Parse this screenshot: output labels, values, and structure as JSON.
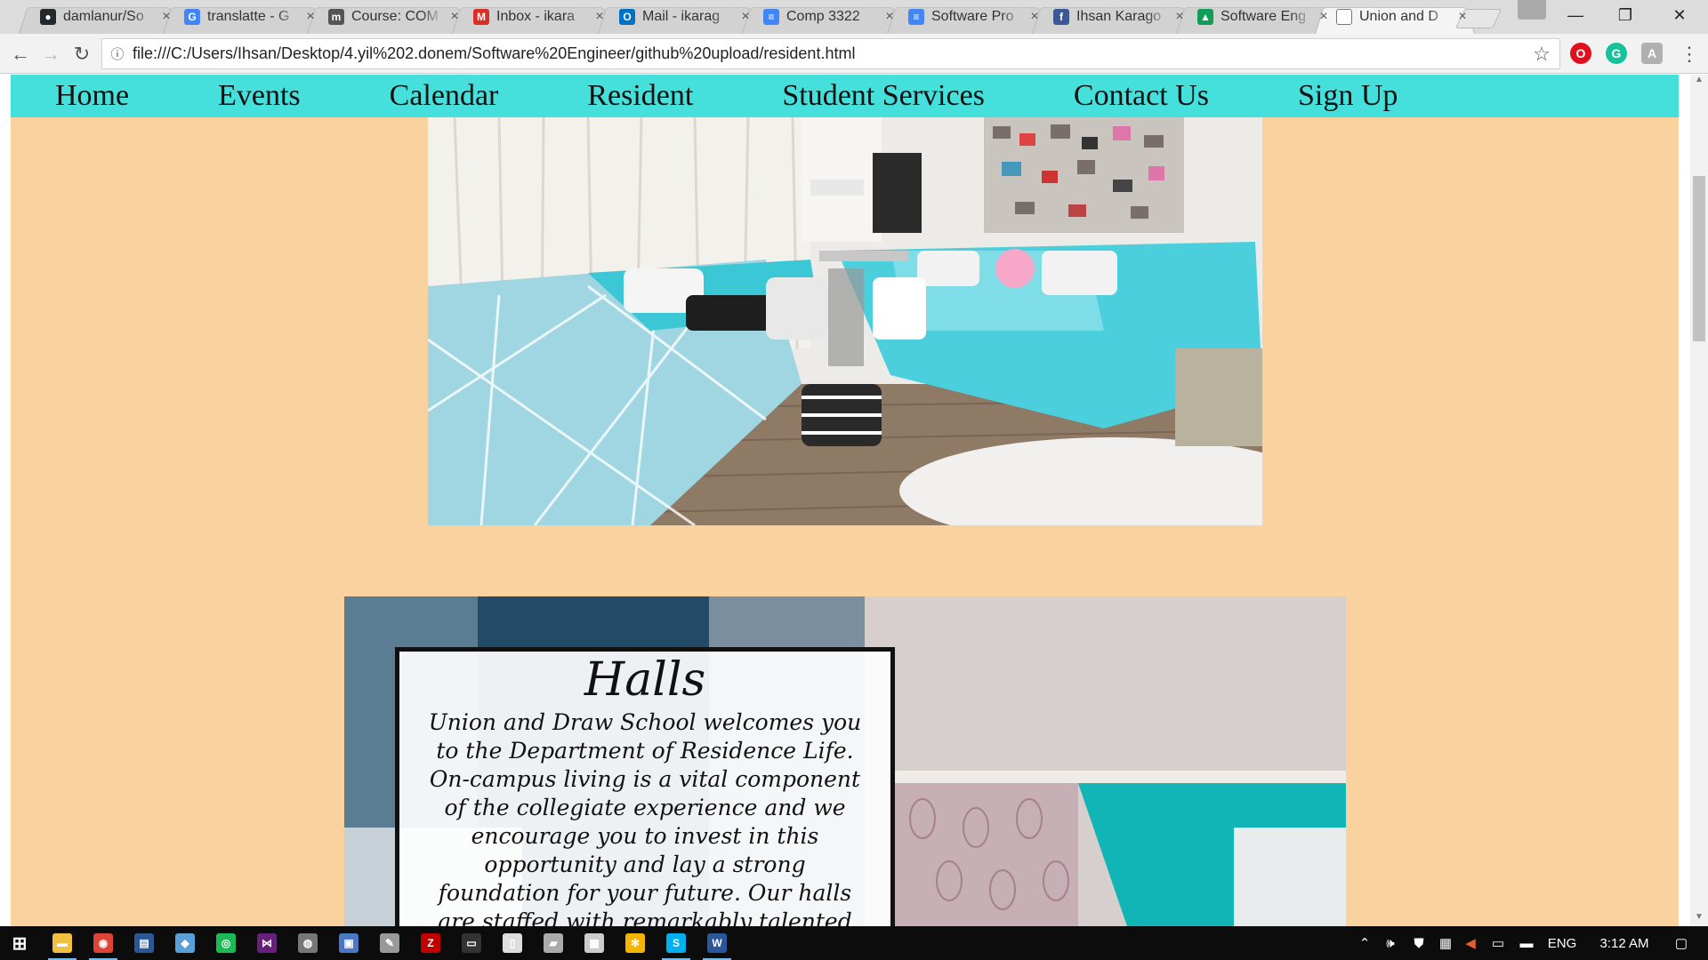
{
  "browser": {
    "tabs": [
      {
        "title": "damlanur/So",
        "icon": "github-icon",
        "color": "#24292e",
        "glyph": "●"
      },
      {
        "title": "translatte - G",
        "icon": "google-icon",
        "color": "#4285f4",
        "glyph": "G"
      },
      {
        "title": "Course: COM",
        "icon": "moodle-icon",
        "color": "#555555",
        "glyph": "m"
      },
      {
        "title": "Inbox - ikara",
        "icon": "gmail-icon",
        "color": "#d93025",
        "glyph": "M"
      },
      {
        "title": "Mail - ikarag",
        "icon": "outlook-icon",
        "color": "#0072c6",
        "glyph": "O"
      },
      {
        "title": "Comp 3322",
        "icon": "google-docs-icon",
        "color": "#4285f4",
        "glyph": "≡"
      },
      {
        "title": "Software Pro",
        "icon": "google-docs-icon",
        "color": "#4285f4",
        "glyph": "≡"
      },
      {
        "title": "Ihsan Karago",
        "icon": "facebook-icon",
        "color": "#3b5998",
        "glyph": "f"
      },
      {
        "title": "Software Eng",
        "icon": "google-drive-icon",
        "color": "#0f9d58",
        "glyph": "▲"
      },
      {
        "title": "Union and D",
        "icon": "page-icon",
        "color": "#ffffff",
        "glyph": "",
        "active": true
      }
    ],
    "close_glyph": "×",
    "window_controls": {
      "minimize": "—",
      "restore": "❐",
      "close": "✕"
    },
    "nav_glyphs": {
      "back": "←",
      "forward": "→",
      "reload": "↻",
      "info": "ⓘ",
      "star": "☆"
    },
    "url": "file:///C:/Users/Ihsan/Desktop/4.yil%202.donem/Software%20Engineer/github%20upload/resident.html",
    "extensions": [
      {
        "name": "opera-icon",
        "color": "#e0101e",
        "glyph": "O"
      },
      {
        "name": "grammarly-icon",
        "color": "#15c39a",
        "glyph": "G"
      },
      {
        "name": "translate-ext-icon",
        "color": "#b0b0b0",
        "glyph": "A"
      }
    ],
    "menu_glyph": "⋮"
  },
  "page": {
    "nav": [
      "Home",
      "Events",
      "Calendar",
      "Resident",
      "Student Services",
      "Contact Us",
      "Sign Up"
    ],
    "halls": {
      "title": "Halls",
      "body": "Union and Draw School welcomes you to the Department of Residence Life. On-campus living is a vital component of the collegiate experience and we encourage you to invest in this opportunity and lay a strong foundation for your future. Our halls are staffed with remarkably talented individuals who want to help"
    },
    "colors": {
      "page_bg": "#f9d29f",
      "nav_bg": "#45e0dc"
    }
  },
  "taskbar": {
    "apps": [
      {
        "name": "start-icon",
        "color": "#ffffff",
        "glyph": "⊞"
      },
      {
        "name": "file-explorer-icon",
        "color": "#f0c040",
        "glyph": "▬",
        "running": true
      },
      {
        "name": "chrome-icon",
        "color": "#db4437",
        "glyph": "◉",
        "running": true
      },
      {
        "name": "app-icon",
        "color": "#2b5797",
        "glyph": "▤"
      },
      {
        "name": "virtualbox-icon",
        "color": "#5aa0d8",
        "glyph": "◆"
      },
      {
        "name": "spotify-icon",
        "color": "#1db954",
        "glyph": "◎"
      },
      {
        "name": "visual-studio-icon",
        "color": "#68217a",
        "glyph": "⋈"
      },
      {
        "name": "steam-icon",
        "color": "#777777",
        "glyph": "◍"
      },
      {
        "name": "network-app-icon",
        "color": "#4a78c2",
        "glyph": "▣"
      },
      {
        "name": "paint-icon",
        "color": "#999999",
        "glyph": "✎"
      },
      {
        "name": "filezilla-icon",
        "color": "#bf0000",
        "glyph": "Z"
      },
      {
        "name": "terminal-icon",
        "color": "#333333",
        "glyph": "▭"
      },
      {
        "name": "notepad-icon",
        "color": "#dddddd",
        "glyph": "▯"
      },
      {
        "name": "disk-icon",
        "color": "#aaaaaa",
        "glyph": "▰"
      },
      {
        "name": "calculator-icon",
        "color": "#cccccc",
        "glyph": "▦"
      },
      {
        "name": "sunflower-icon",
        "color": "#f4b400",
        "glyph": "✻"
      },
      {
        "name": "skype-icon",
        "color": "#00aff0",
        "glyph": "S",
        "running": true
      },
      {
        "name": "word-icon",
        "color": "#2b579a",
        "glyph": "W",
        "running": true
      }
    ],
    "language": "ENG",
    "time": "3:12 AM"
  }
}
